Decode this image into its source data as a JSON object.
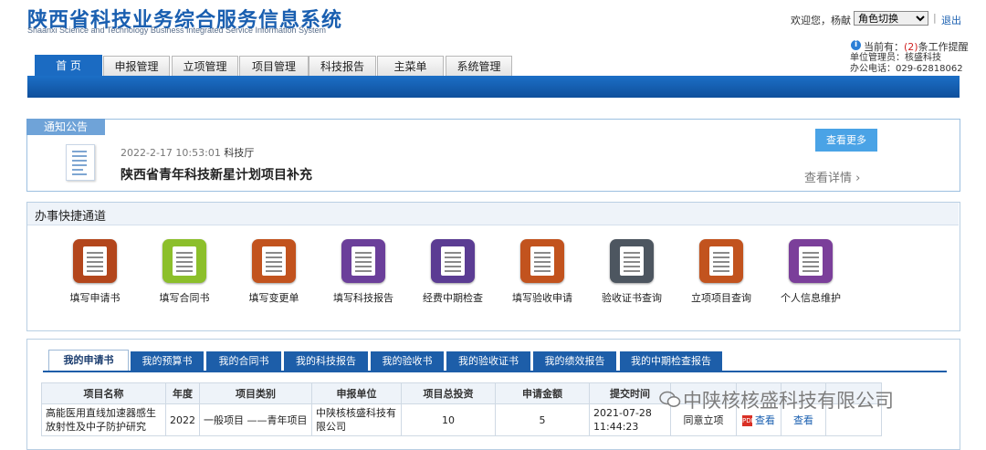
{
  "header": {
    "title_cn": "陕西省科技业务综合服务信息系统",
    "title_en": "Shaanxi Science and Technology Business Integrated Service Information System",
    "welcome": "欢迎您，杨献",
    "role_switch": "角色切换",
    "separator": "|",
    "logout": "退出",
    "current_prefix": "当前有：",
    "current_count": "(2)",
    "current_suffix": "条工作提醒",
    "unit_manager": "单位管理员：核盛科技",
    "office_phone": "办公电话：029-62818062"
  },
  "nav": {
    "tabs": [
      "首 页",
      "申报管理",
      "立项管理",
      "项目管理",
      "科技报告",
      "主菜单",
      "系统管理"
    ],
    "active_index": 0
  },
  "notice": {
    "label": "通知公告",
    "date": "2022-2-17 10:53:01",
    "source": "科技厅",
    "title": "陕西省青年科技新星计划项目补充",
    "more_button": "查看更多",
    "detail_link": "查看详情 ›"
  },
  "quick": {
    "title": "办事快捷通道",
    "items": [
      {
        "label": "填写申请书",
        "icon": "fill-application-icon",
        "color": "#b3461c"
      },
      {
        "label": "填写合同书",
        "icon": "fill-contract-icon",
        "color": "#8cbf2b"
      },
      {
        "label": "填写变更单",
        "icon": "fill-change-form-icon",
        "color": "#c2531e"
      },
      {
        "label": "填写科技报告",
        "icon": "fill-tech-report-icon",
        "color": "#6b3f9a"
      },
      {
        "label": "经费中期检查",
        "icon": "funding-check-icon",
        "color": "#5b3c93"
      },
      {
        "label": "填写验收申请",
        "icon": "fill-acceptance-icon",
        "color": "#c2531e"
      },
      {
        "label": "验收证书查询",
        "icon": "certificate-query-icon",
        "color": "#4d5660"
      },
      {
        "label": "立项项目查询",
        "icon": "project-query-icon",
        "color": "#c2531e"
      },
      {
        "label": "个人信息维护",
        "icon": "personal-info-icon",
        "color": "#7b3f9a"
      }
    ]
  },
  "list": {
    "tabs": [
      "我的申请书",
      "我的预算书",
      "我的合同书",
      "我的科技报告",
      "我的验收书",
      "我的验收证书",
      "我的绩效报告",
      "我的中期检查报告"
    ],
    "active_index": 0,
    "columns": [
      "项目名称",
      "年度",
      "项目类别",
      "申报单位",
      "项目总投资",
      "申请金额",
      "提交时间",
      "",
      "",
      "",
      ""
    ],
    "rows": [
      {
        "name": "高能医用直线加速器感生放射性及中子防护研究",
        "year": "2022",
        "category": "一般项目 ——青年项目",
        "unit": "中陕核核盛科技有限公司",
        "total": "10",
        "amount": "5",
        "submit_time": "2021-07-28 11:44:23",
        "status": "同意立项",
        "view1": "查看",
        "view2": "查看"
      }
    ]
  },
  "watermark": "中陕核核盛科技有限公司"
}
